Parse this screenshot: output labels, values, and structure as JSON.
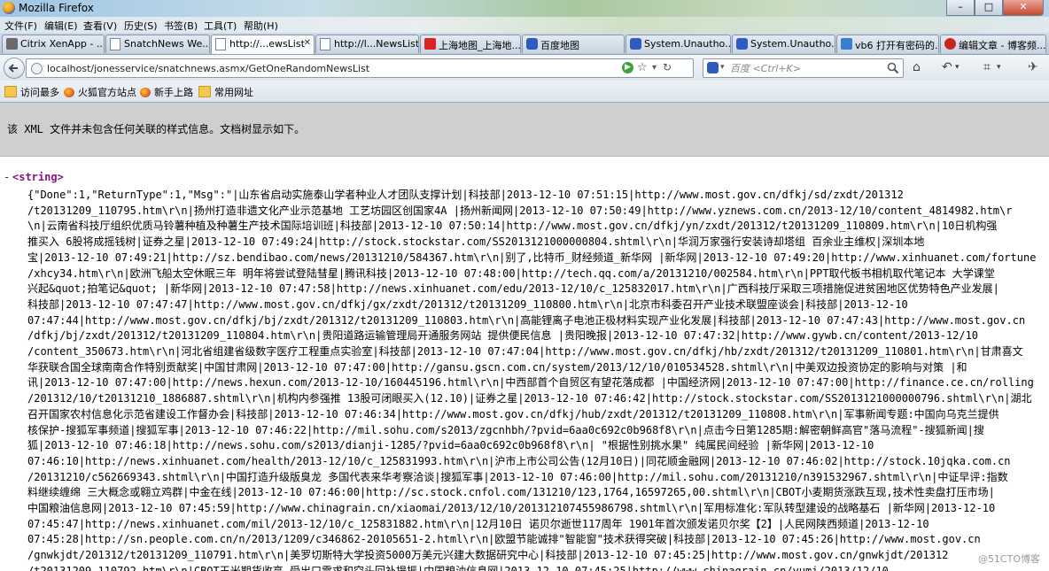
{
  "window": {
    "title": "Mozilla Firefox",
    "buttons": {
      "minimize": "–",
      "maximize": "□",
      "close": "✕"
    }
  },
  "menubar": [
    "文件(F)",
    "编辑(E)",
    "查看(V)",
    "历史(S)",
    "书签(B)",
    "工具(T)",
    "帮助(H)"
  ],
  "tabs": [
    {
      "label": "Citrix XenApp - ...",
      "icon": "citrix-icon"
    },
    {
      "label": "SnatchNews We...",
      "icon": "page-icon"
    },
    {
      "label": "http://...ewsList",
      "icon": "page-icon",
      "active": true
    },
    {
      "label": "http://l...NewsList",
      "icon": "page-icon"
    },
    {
      "label": "上海地图_上海地...",
      "icon": "red-page-icon"
    },
    {
      "label": "百度地图",
      "icon": "paw-icon"
    },
    {
      "label": "System.Unautho...",
      "icon": "paw-icon"
    },
    {
      "label": "System.Unautho...",
      "icon": "paw-icon"
    },
    {
      "label": "vb6 打开有密码的...",
      "icon": "vb-icon"
    },
    {
      "label": "编辑文章 - 博客频...",
      "icon": "blog-icon"
    }
  ],
  "navbar": {
    "url": "localhost/jonesservice/snatchnews.asmx/GetOneRandomNewsList",
    "search_placeholder": "百度 <Ctrl+K>"
  },
  "bookmarks": [
    {
      "label": "访问最多",
      "icon": "folder"
    },
    {
      "label": "火狐官方站点",
      "icon": "firefox"
    },
    {
      "label": "新手上路",
      "icon": "firefox"
    },
    {
      "label": "常用网址",
      "icon": "folder"
    }
  ],
  "xml_info": "该 XML 文件并未包含任何关联的样式信息。文档树显示如下。",
  "xml": {
    "toggle": "-",
    "open_tag": "<string>",
    "lines": [
      "{\"Done\":1,\"ReturnType\":1,\"Msg\":\"|山东省启动实施泰山学者种业人才团队支撑计划|科技部|2013-12-10 07:51:15|http://www.most.gov.cn/dfkj/sd/zxdt/201312",
      "/t20131209_110795.htm\\r\\n|扬州打造非遗文化产业示范基地 工艺坊园区创国家4A |扬州新闻网|2013-12-10 07:50:49|http://www.yznews.com.cn/2013-12/10/content_4814982.htm\\r",
      "\\n|云南省科技厅组织优质马铃薯种植及种薯生产技术国际培训班|科技部|2013-12-10 07:50:14|http://www.most.gov.cn/dfkj/yn/zxdt/201312/t20131209_110809.htm\\r\\n|10日机构强",
      "推买入 6股将成摇钱树|证券之星|2013-12-10 07:49:24|http://stock.stockstar.com/SS2013121000000804.shtml\\r\\n|华润万家强行安装诗却塔组 百余业主维权|深圳本地",
      "宝|2013-12-10 07:49:21|http://sz.bendibao.com/news/20131210/584367.htm\\r\\n|别了,比特币_财经频道_新华网 |新华网|2013-12-10 07:49:20|http://www.xinhuanet.com/fortune",
      "/xhcy34.htm\\r\\n|欧洲飞船太空休眠三年 明年将尝试登陆彗星|腾讯科技|2013-12-10 07:48:00|http://tech.qq.com/a/20131210/002584.htm\\r\\n|PPT取代板书相机取代笔记本 大学课堂",
      "兴起&quot;拍笔记&quot; |新华网|2013-12-10 07:47:58|http://news.xinhuanet.com/edu/2013-12/10/c_125832017.htm\\r\\n|广西科技厅采取三项措施促进贫困地区优势特色产业发展|",
      "科技部|2013-12-10 07:47:47|http://www.most.gov.cn/dfkj/gx/zxdt/201312/t20131209_110800.htm\\r\\n|北京市科委召开产业技术联盟座谈会|科技部|2013-12-10",
      "07:47:44|http://www.most.gov.cn/dfkj/bj/zxdt/201312/t20131209_110803.htm\\r\\n|高能锂离子电池正极材料实现产业化发展|科技部|2013-12-10 07:47:43|http://www.most.gov.cn",
      "/dfkj/bj/zxdt/201312/t20131209_110804.htm\\r\\n|贵阳道路运输管理局开通服务网站 提供便民信息 |贵阳晚报|2013-12-10 07:47:32|http://www.gywb.cn/content/2013-12/10",
      "/content_350673.htm\\r\\n|河北省组建省级数字医疗工程重点实验室|科技部|2013-12-10 07:47:04|http://www.most.gov.cn/dfkj/hb/zxdt/201312/t20131209_110801.htm\\r\\n|甘肃喜文",
      "华获联合国全球南南合作特别贡献奖|中国甘肃网|2013-12-10 07:47:00|http://gansu.gscn.com.cn/system/2013/12/10/010534528.shtml\\r\\n|中美双边投资协定的影响与对策 |和",
      "讯|2013-12-10 07:47:00|http://news.hexun.com/2013-12-10/160445196.html\\r\\n|中西部首个自贸区有望花落成都 |中国经济网|2013-12-10 07:47:00|http://finance.ce.cn/rolling",
      "/201312/10/t20131210_1886887.shtml\\r\\n|机构内参强推 13股可闭眼买入(12.10)|证券之星|2013-12-10 07:46:42|http://stock.stockstar.com/SS2013121000000796.shtml\\r\\n|湖北",
      "召开国家农村信息化示范省建设工作督办会|科技部|2013-12-10 07:46:34|http://www.most.gov.cn/dfkj/hub/zxdt/201312/t20131209_110808.htm\\r\\n|军事新闻专题:中国向乌克兰提供",
      "核保护-搜狐军事频道|搜狐军事|2013-12-10 07:46:22|http://mil.sohu.com/s2013/zgcnhbh/?pvid=6aa0c692c0b968f8\\r\\n|点击今日第1285期:解密朝鲜高官\"落马流程\"-搜狐新闻|搜",
      "狐|2013-12-10 07:46:18|http://news.sohu.com/s2013/dianji-1285/?pvid=6aa0c692c0b968f8\\r\\n| \"根据性别挑水果\" 纯属民间经验 |新华网|2013-12-10",
      "07:46:10|http://news.xinhuanet.com/health/2013-12/10/c_125831993.htm\\r\\n|沪市上市公司公告(12月10日)|同花顺金融网|2013-12-10 07:46:02|http://stock.10jqka.com.cn",
      "/20131210/c562669343.shtml\\r\\n|中国打造升级版臭龙 多国代表来华考察洽谈|搜狐军事|2013-12-10 07:46:00|http://mil.sohu.com/20131210/n391532967.shtml\\r\\n|中证早评:指数",
      "料继续缠绵 三大概念或翱立鸡群|中金在线|2013-12-10 07:46:00|http://sc.stock.cnfol.com/131210/123,1764,16597265,00.shtml\\r\\n|CBOT小麦期货涨跌互现,技术性卖盘打压市场|",
      "中国粮油信息网|2013-12-10 07:45:59|http://www.chinagrain.cn/xiaomai/2013/12/10/201312107455986798.shtml\\r\\n|军用标准化:军队转型建设的战略基石 |新华网|2013-12-10",
      "07:45:47|http://news.xinhuanet.com/mil/2013-12/10/c_125831882.htm\\r\\n|12月10日 诺贝尔逝世117周年 1901年首次颁发诺贝尔奖【2】|人民网陕西频道|2013-12-10",
      "07:45:28|http://sn.people.com.cn/n/2013/1209/c346862-20105651-2.html\\r\\n|欧盟节能诚排\"智能窗\"技术获得突破|科技部|2013-12-10 07:45:26|http://www.most.gov.cn",
      "/gnwkjdt/201312/t20131209_110791.htm\\r\\n|美罗切斯特大学投资5000万美元兴建大数据研究中心|科技部|2013-12-10 07:45:25|http://www.most.gov.cn/gnwkjdt/201312",
      "/t20131209_110792.htm\\r\\n|CBOT玉米期货收高,受出口需求和空头回补提振|中国粮油信息网|2013-12-10 07:45:25|http://www.chinagrain.cn/yumi/2013/12/10"
    ]
  },
  "watermark": "@51CTO博客"
}
